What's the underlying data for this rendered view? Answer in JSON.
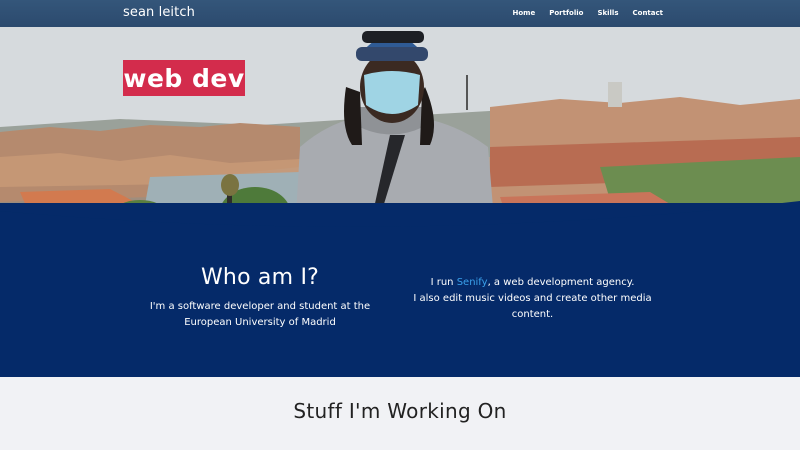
{
  "nav": {
    "brand": "sean leitch",
    "links": [
      "Home",
      "Portfolio",
      "Skills",
      "Contact"
    ]
  },
  "hero": {
    "badge": "web dev"
  },
  "about": {
    "title": "Who am I?",
    "left_text": "I'm a software developer and student at the European University of Madrid",
    "right_prefix": "I run ",
    "right_link": "Senify",
    "right_suffix": ", a web development agency.",
    "right_line2": "I also edit music videos and create other media content."
  },
  "working": {
    "title": "Stuff I'm Working On"
  },
  "colors": {
    "nav": "#2c4a6e",
    "badge": "#d32c4c",
    "about_bg": "#052a69",
    "link": "#3aa0ea"
  }
}
